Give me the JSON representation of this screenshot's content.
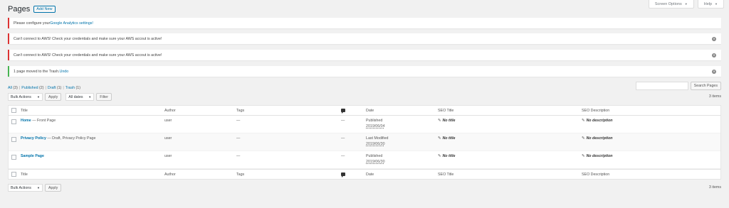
{
  "header": {
    "title": "Pages",
    "add_new": "Add New",
    "screen_options": "Screen Options",
    "help": "Help"
  },
  "notices": [
    {
      "text": "Please configure your ",
      "link": "Google Analytics settings!",
      "type": "error",
      "dismiss": false
    },
    {
      "text": "Can't connect to AWS! Check your credentials and make sure your AWS accout is active!",
      "type": "error",
      "dismiss": true
    },
    {
      "text": "Can't connect to AWS! Check your credentials and make sure your AWS accout is active!",
      "type": "error",
      "dismiss": true
    },
    {
      "text": "1 page moved to the Trash. ",
      "link": "Undo",
      "type": "success",
      "dismiss": true
    }
  ],
  "filters": {
    "all": "All",
    "all_count": "(3)",
    "published": "Published",
    "published_count": "(2)",
    "draft": "Draft",
    "draft_count": "(1)",
    "trash": "Trash",
    "trash_count": "(1)",
    "sep": "|"
  },
  "search": {
    "button": "Search Pages"
  },
  "tablenav": {
    "bulk_actions": "Bulk Actions",
    "apply": "Apply",
    "all_dates": "All dates",
    "filter": "Filter",
    "items": "3 items"
  },
  "columns": {
    "title": "Title",
    "author": "Author",
    "tags": "Tags",
    "date": "Date",
    "seo_title": "SEO Title",
    "seo_description": "SEO Description"
  },
  "rows": [
    {
      "title": "Home",
      "state": " — Front Page",
      "author": "user",
      "tags": "—",
      "comments": "—",
      "date_status": "Published",
      "date": "2019/06/04",
      "seo_title": "No title",
      "seo_desc": "No description"
    },
    {
      "title": "Privacy Policy",
      "state": " — Draft, Privacy Policy Page",
      "author": "user",
      "tags": "—",
      "comments": "—",
      "date_status": "Last Modified",
      "date": "2019/06/30",
      "seo_title": "No title",
      "seo_desc": "No description"
    },
    {
      "title": "Sample Page",
      "state": "",
      "author": "user",
      "tags": "—",
      "comments": "—",
      "date_status": "Published",
      "date": "2019/06/30",
      "seo_title": "No title",
      "seo_desc": "No description"
    }
  ],
  "icons": {
    "dismiss": "dismiss-icon",
    "comments": "comment-bubble-icon",
    "pencil": "pencil-icon",
    "caret": "caret-down-icon"
  },
  "colors": {
    "link": "#0073aa",
    "error": "#dc3232",
    "success": "#46b450",
    "background": "#f1f1f1"
  }
}
